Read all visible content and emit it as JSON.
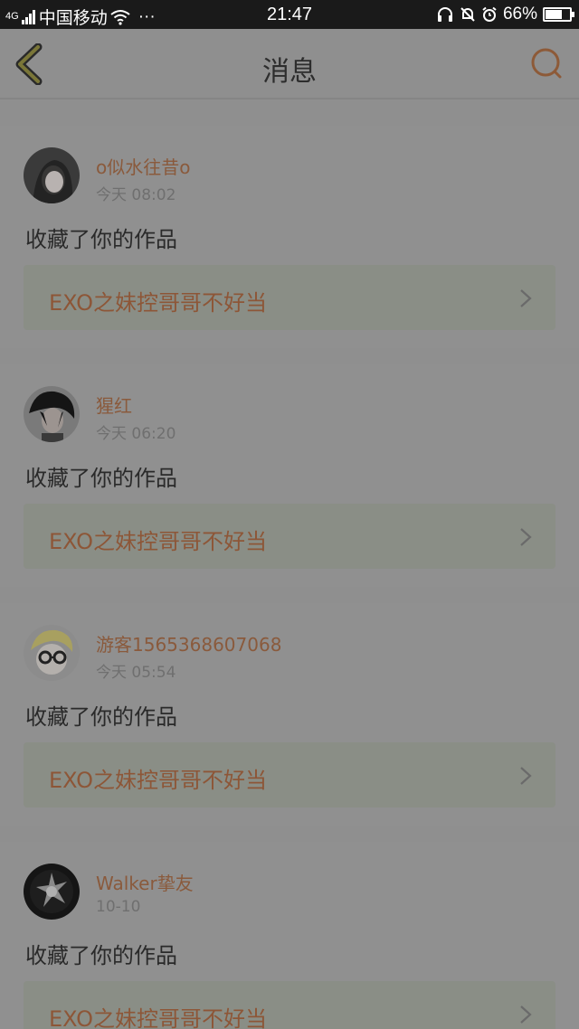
{
  "status_bar": {
    "network": "4G",
    "carrier": "中国移动",
    "more": "···",
    "time": "21:47",
    "battery_percent": "66%",
    "battery_level": 0.66
  },
  "nav": {
    "title": "消息"
  },
  "messages": [
    {
      "username": "o似水往昔o",
      "time": "今天 08:02",
      "action": "收藏了你的作品",
      "work_title": "EXO之妹控哥哥不好当"
    },
    {
      "username": "猩红",
      "time": "今天 06:20",
      "action": "收藏了你的作品",
      "work_title": "EXO之妹控哥哥不好当"
    },
    {
      "username": "游客1565368607068",
      "time": "今天 05:54",
      "action": "收藏了你的作品",
      "work_title": "EXO之妹控哥哥不好当"
    },
    {
      "username": "Walker挚友",
      "time": "10-10",
      "action": "收藏了你的作品",
      "work_title": "EXO之妹控哥哥不好当"
    }
  ]
}
